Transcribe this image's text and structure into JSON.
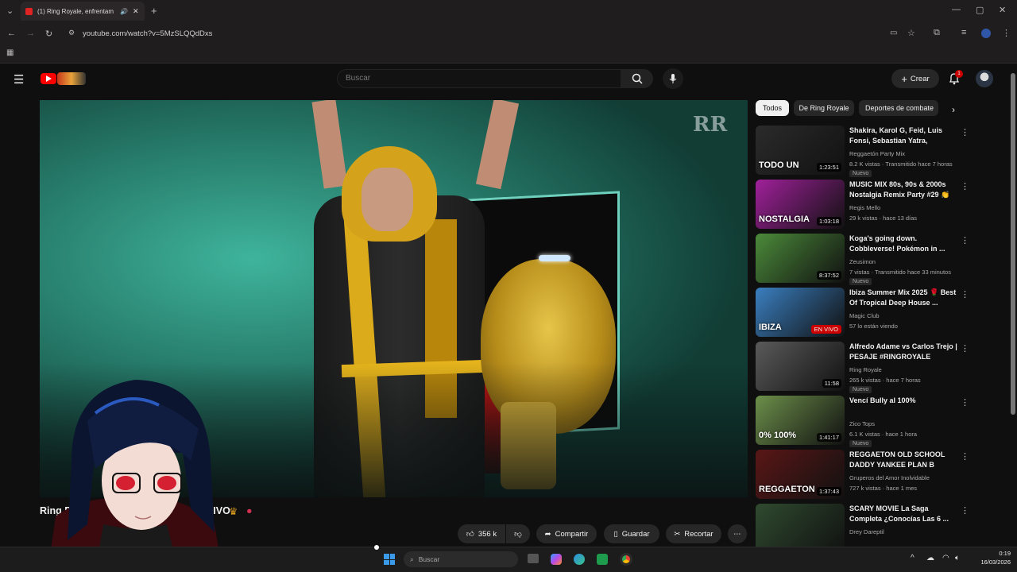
{
  "browser": {
    "tab_title": "(1) Ring Royale, enfrentam",
    "url": "youtube.com/watch?v=5MzSLQQdDxs"
  },
  "header": {
    "search_placeholder": "Buscar",
    "create_label": "Crear",
    "notification_count": "1"
  },
  "chips": [
    "Todos",
    "De Ring Royale",
    "Deportes de combate"
  ],
  "video": {
    "title_visible_start": "Ring Ro",
    "title_visible_end": "VIVO",
    "watermark": "RR"
  },
  "actions": {
    "likes": "356 k",
    "share": "Compartir",
    "save": "Guardar",
    "clip": "Recortar"
  },
  "recommendations": [
    {
      "title": "Shakira, Karol G, Feid, Luis Fonsi, Sebastian Yatra, Nacho,...",
      "channel": "Reggaetón Party Mix",
      "meta": "8.2 K vistas · Transmitido hace 7 horas",
      "badge": "Nuevo",
      "duration": "1:23:51",
      "thumb_text": "TODO UN",
      "thumb_color": "#2b2b2b"
    },
    {
      "title": "MUSIC MIX 80s, 90s & 2000s Nostalgia Remix Party #29 👏 ...",
      "channel": "Regis Mello",
      "meta": "29 k vistas · hace 13 días",
      "badge": "",
      "duration": "1:03:18",
      "thumb_text": "NOSTALGIA",
      "thumb_color": "#a0209a"
    },
    {
      "title": "Koga's going down. Cobbleverse! Pokémon in ...",
      "channel": "Zeusimon",
      "meta": "7 vistas · Transmitido hace 33 minutos",
      "badge": "Nuevo",
      "duration": "8:37:52",
      "thumb_text": "",
      "thumb_color": "#4b8a3a"
    },
    {
      "title": "Ibiza Summer Mix 2025 🌹 Best Of Tropical Deep House ...",
      "channel": "Magic Club",
      "meta": "57 lo están viendo",
      "badge": "",
      "duration": "EN VIVO",
      "thumb_text": "IBIZA",
      "thumb_color": "#3a7fc0"
    },
    {
      "title": "Alfredo Adame vs Carlos Trejo | PESAJE #RINGROYALE",
      "channel": "Ring Royale",
      "meta": "265 k vistas · hace 7 horas",
      "badge": "Nuevo",
      "duration": "11:58",
      "thumb_text": "",
      "thumb_color": "#5a5a5a"
    },
    {
      "title": "Vencí Bully al 100%",
      "channel": "Zico Tops",
      "meta": "6.1 K vistas · hace 1 hora",
      "badge": "Nuevo",
      "duration": "1:41:17",
      "thumb_text": "0%  100%",
      "thumb_color": "#6c8f4a"
    },
    {
      "title": "REGGAETON OLD SCHOOL DADDY YANKEE PLAN B CALL...",
      "channel": "Gruperos del Amor Inolvidable",
      "meta": "727 k vistas · hace 1 mes",
      "badge": "",
      "duration": "1:37:43",
      "thumb_text": "REGGAETON",
      "thumb_color": "#5a1616"
    },
    {
      "title": "SCARY MOVIE La Saga Completa ¿Conocías Las 6 ...",
      "channel": "Drey Dareptil",
      "meta": "",
      "badge": "",
      "duration": "",
      "thumb_text": "",
      "thumb_color": "#2f4a2f"
    }
  ],
  "taskbar": {
    "search_placeholder": "Buscar",
    "time": "0:19",
    "date": "16/03/2026"
  },
  "colors": {
    "yt_red": "#ff0000",
    "bg": "#0f0f0f"
  }
}
